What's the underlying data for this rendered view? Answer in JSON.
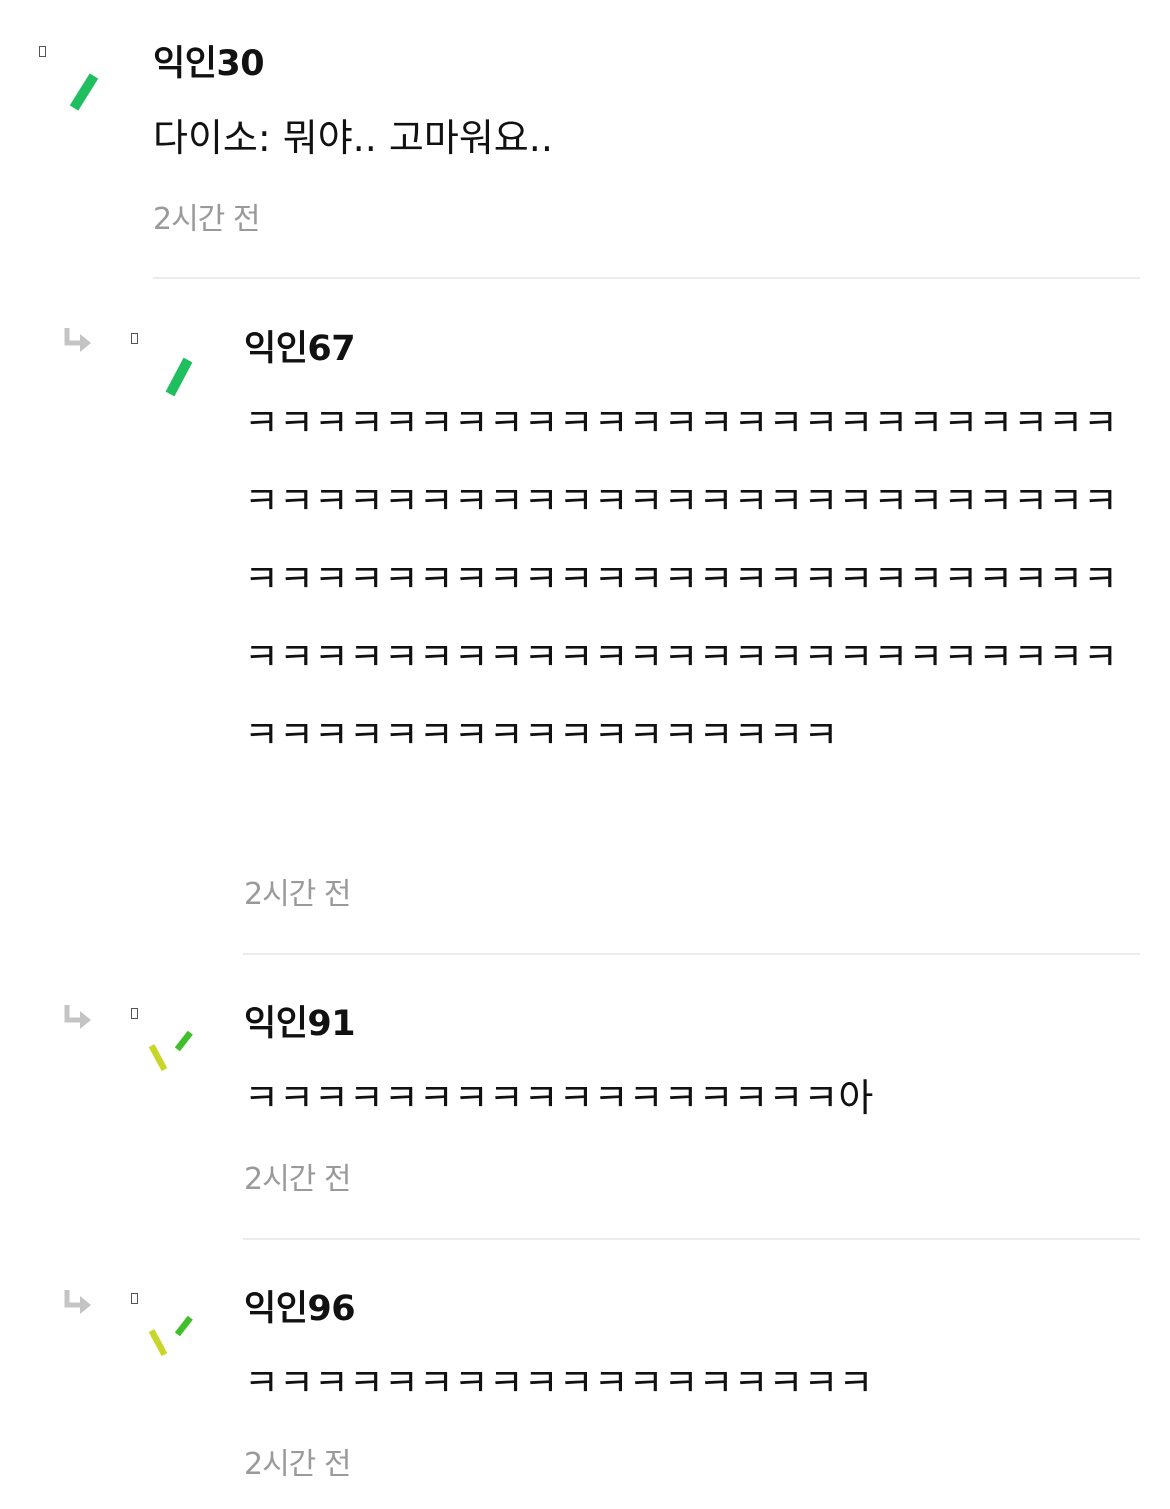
{
  "comments": [
    {
      "nickname": "익인30",
      "content": "다이소: 뭐야.. 고마워요..",
      "time": "2시간 전",
      "is_reply": false,
      "avatar_icon": "single-green-stroke-icon",
      "avatar_colors": [
        "#1fbf5f"
      ]
    },
    {
      "nickname": "익인67",
      "content": "ㅋㅋㅋㅋㅋㅋㅋㅋㅋㅋㅋㅋㅋㅋㅋㅋㅋㅋㅋㅋㅋㅋㅋㅋㅋㅋㅋㅋㅋㅋㅋㅋㅋㅋㅋㅋㅋㅋㅋㅋㅋㅋㅋㅋㅋㅋㅋㅋㅋㅋㅋㅋㅋㅋㅋㅋㅋㅋㅋㅋㅋㅋㅋㅋㅋㅋㅋㅋㅋㅋㅋㅋㅋㅋㅋㅋㅋㅋㅋㅋㅋㅋㅋㅋㅋㅋㅋㅋㅋㅋㅋㅋㅋㅋㅋㅋㅋㅋㅋㅋㅋㅋㅋㅋㅋㅋㅋㅋㅋㅋㅋㅋㅋㅋㅋㅋㅋ",
      "time": "2시간 전",
      "is_reply": true,
      "avatar_icon": "single-green-stroke-icon",
      "avatar_colors": [
        "#1fbf5f"
      ]
    },
    {
      "nickname": "익인91",
      "content": "ㅋㅋㅋㅋㅋㅋㅋㅋㅋㅋㅋㅋㅋㅋㅋㅋㅋ아",
      "time": "2시간 전",
      "is_reply": true,
      "avatar_icon": "double-stroke-icon",
      "avatar_colors": [
        "#c8d62a",
        "#3fc02a"
      ]
    },
    {
      "nickname": "익인96",
      "content": "ㅋㅋㅋㅋㅋㅋㅋㅋㅋㅋㅋㅋㅋㅋㅋㅋㅋㅋ",
      "time": "2시간 전",
      "is_reply": true,
      "avatar_icon": "double-stroke-icon",
      "avatar_colors": [
        "#c8d62a",
        "#3fc02a"
      ]
    }
  ],
  "colors": {
    "timestamp": "#9a9a9a",
    "divider": "#ececec",
    "reply_arrow": "#c4c4c4"
  }
}
